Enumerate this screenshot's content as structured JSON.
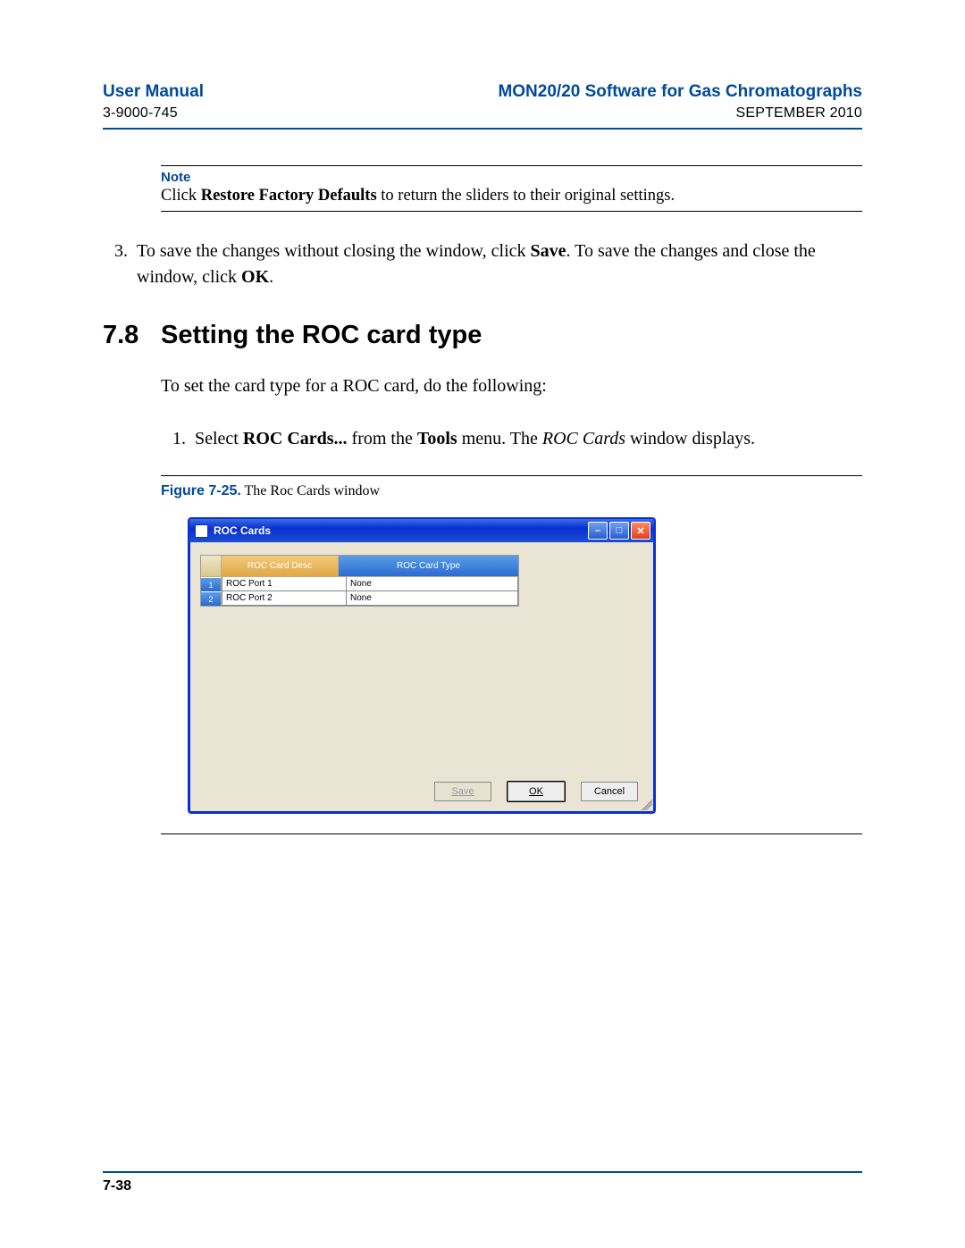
{
  "header": {
    "left_title": "User Manual",
    "left_sub": "3-9000-745",
    "right_title": "MON20/20 Software for Gas Chromatographs",
    "right_sub": "SEPTEMBER 2010"
  },
  "note": {
    "label": "Note",
    "pre": "Click ",
    "bold": "Restore Factory Defaults",
    "post": " to return the sliders to their original settings."
  },
  "step3": {
    "num": "3.",
    "t1": "To save the changes without closing the window, click ",
    "b1": "Save",
    "t2": ". To save the changes and close the window, click ",
    "b2": "OK",
    "t3": "."
  },
  "section": {
    "num": "7.8",
    "title": "Setting the ROC card type",
    "intro": "To set the card type for a ROC card, do the following:"
  },
  "step1": {
    "num": "1.",
    "t1": "Select ",
    "b1": "ROC Cards...",
    "t2": " from the ",
    "b2": "Tools",
    "t3": " menu.  The ",
    "i1": "ROC Cards",
    "t4": " window displays."
  },
  "figure": {
    "label": "Figure 7-25.",
    "caption": "  The Roc Cards window"
  },
  "window": {
    "title": "ROC Cards",
    "col_desc": "ROC Card Desc",
    "col_type": "ROC Card Type",
    "rows": [
      {
        "n": "1",
        "desc": "ROC Port 1",
        "type": "None"
      },
      {
        "n": "2",
        "desc": "ROC Port 2",
        "type": "None"
      }
    ],
    "buttons": {
      "save": "Save",
      "ok": "OK",
      "cancel": "Cancel"
    }
  },
  "footer": {
    "page": "7-38"
  }
}
